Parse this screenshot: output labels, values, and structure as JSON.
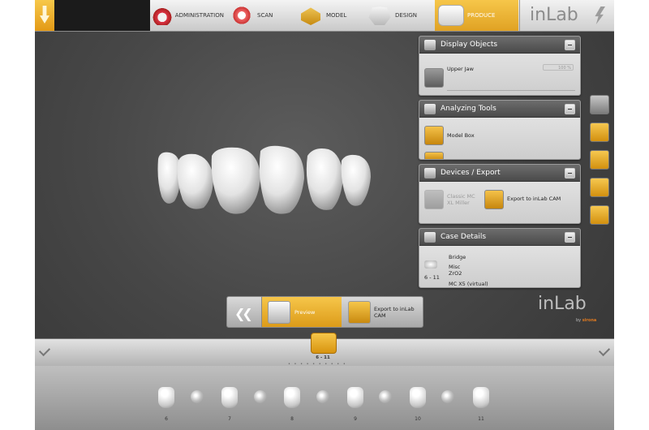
{
  "topbar": {
    "steps": [
      {
        "label": "ADMINISTRATION",
        "icon": "teeth-admin-icon"
      },
      {
        "label": "SCAN",
        "icon": "jaw-scan-icon"
      },
      {
        "label": "MODEL",
        "icon": "model-icon"
      },
      {
        "label": "DESIGN",
        "icon": "design-icon"
      },
      {
        "label": "PRODUCE",
        "icon": "produce-icon",
        "active": true
      }
    ],
    "brand": "inLab"
  },
  "panels": {
    "display_objects": {
      "title": "Display Objects",
      "item": "Upper Jaw",
      "value": "100 %"
    },
    "analyzing_tools": {
      "title": "Analyzing Tools",
      "item": "Model Box"
    },
    "devices_export": {
      "title": "Devices / Export",
      "device_disabled": "Classic MC XL Miller",
      "device_enabled": "Export to inLab CAM"
    },
    "case_details": {
      "title": "Case Details",
      "restoration": "Bridge",
      "material_line1": "Misc",
      "material_line2": "ZrO2",
      "teeth": "6 - 11",
      "machine": "MC X5 (virtual)"
    }
  },
  "actionbar": {
    "preview": "Preview",
    "export_line1": "Export to inLab",
    "export_line2": "CAM"
  },
  "watermark": {
    "brand": "inLab",
    "by": "by",
    "company": "sirona"
  },
  "case_strip": {
    "badge_label": "6 - 11",
    "dots": "• • • • • • • • • •"
  },
  "palette": {
    "numbers": [
      "6",
      "7",
      "8",
      "9",
      "10",
      "11"
    ]
  },
  "colors": {
    "accent": "#F0B43A",
    "background": "#474747",
    "panel_header": "#555555"
  }
}
